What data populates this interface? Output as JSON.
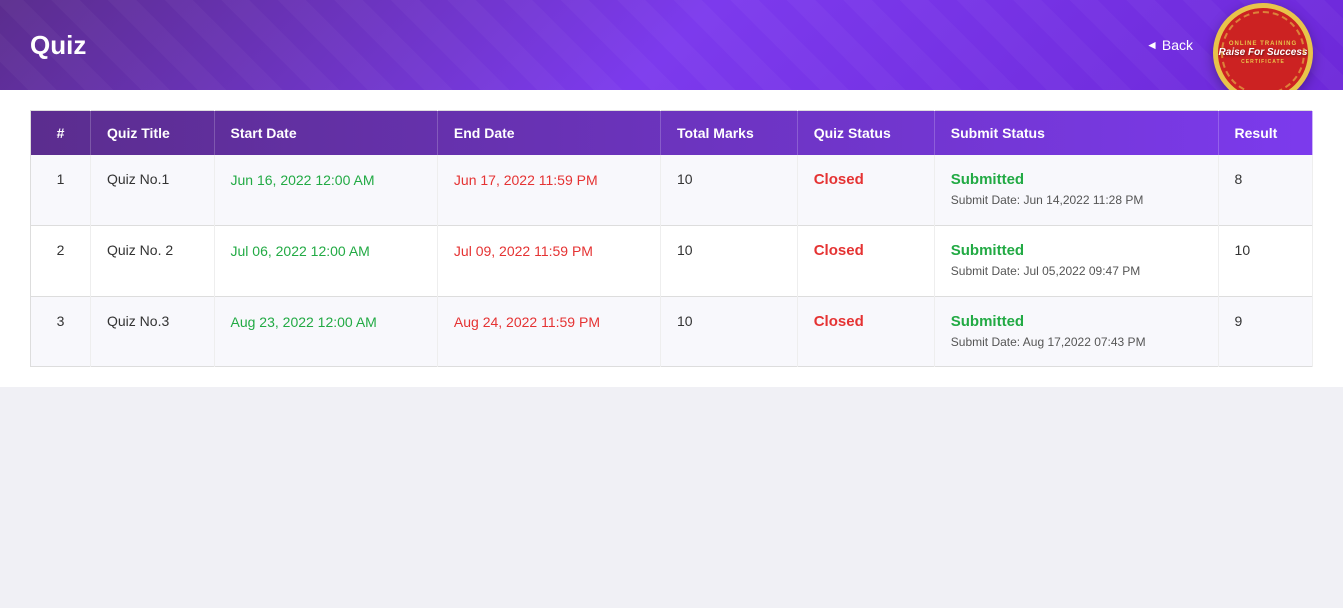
{
  "header": {
    "title": "Quiz",
    "back_label": "Back",
    "badge_top": "ONLINE TRAINING",
    "badge_main": "Raise For Success",
    "badge_bottom": "CERTIFICATE"
  },
  "table": {
    "columns": [
      "#",
      "Quiz Title",
      "Start Date",
      "End Date",
      "Total Marks",
      "Quiz Status",
      "Submit Status",
      "Result"
    ],
    "rows": [
      {
        "num": "1",
        "title": "Quiz No.1",
        "start_date": "Jun 16, 2022 12:00 AM",
        "end_date": "Jun 17, 2022 11:59 PM",
        "total_marks": "10",
        "quiz_status": "Closed",
        "submit_status": "Submitted",
        "submit_date": "Submit Date: Jun 14,2022 11:28 PM",
        "result": "8"
      },
      {
        "num": "2",
        "title": "Quiz No. 2",
        "start_date": "Jul 06, 2022 12:00 AM",
        "end_date": "Jul 09, 2022 11:59 PM",
        "total_marks": "10",
        "quiz_status": "Closed",
        "submit_status": "Submitted",
        "submit_date": "Submit Date: Jul 05,2022 09:47 PM",
        "result": "10"
      },
      {
        "num": "3",
        "title": "Quiz No.3",
        "start_date": "Aug 23, 2022 12:00 AM",
        "end_date": "Aug 24, 2022 11:59 PM",
        "total_marks": "10",
        "quiz_status": "Closed",
        "submit_status": "Submitted",
        "submit_date": "Submit Date: Aug 17,2022 07:43 PM",
        "result": "9"
      }
    ]
  }
}
